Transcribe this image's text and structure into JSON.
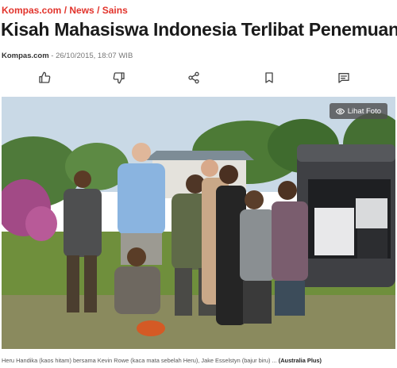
{
  "breadcrumb": {
    "site": "Kompas.com",
    "sep": " / ",
    "section": "News",
    "subsection": "Sains"
  },
  "article": {
    "title": "Kisah Mahasiswa Indonesia Terlibat Penemuan",
    "source": "Kompas.com",
    "datetime": " - 26/10/2015, 18:07 WIB"
  },
  "actions": [
    {
      "icon": "thumbs-up-icon"
    },
    {
      "icon": "thumbs-down-icon"
    },
    {
      "icon": "share-icon"
    },
    {
      "icon": "bookmark-icon"
    },
    {
      "icon": "comment-icon"
    }
  ],
  "photo": {
    "view_label": "Lihat Foto",
    "caption": "Heru Handika (kaos hitam) bersama Kevin Rowe (kaca mata sebelah Heru), Jake Esselstyn (bajur biru) ...",
    "credit": "(Australia Plus)"
  },
  "colors": {
    "accent": "#e2332b",
    "text": "#1a1a1a",
    "meta": "#777777"
  }
}
